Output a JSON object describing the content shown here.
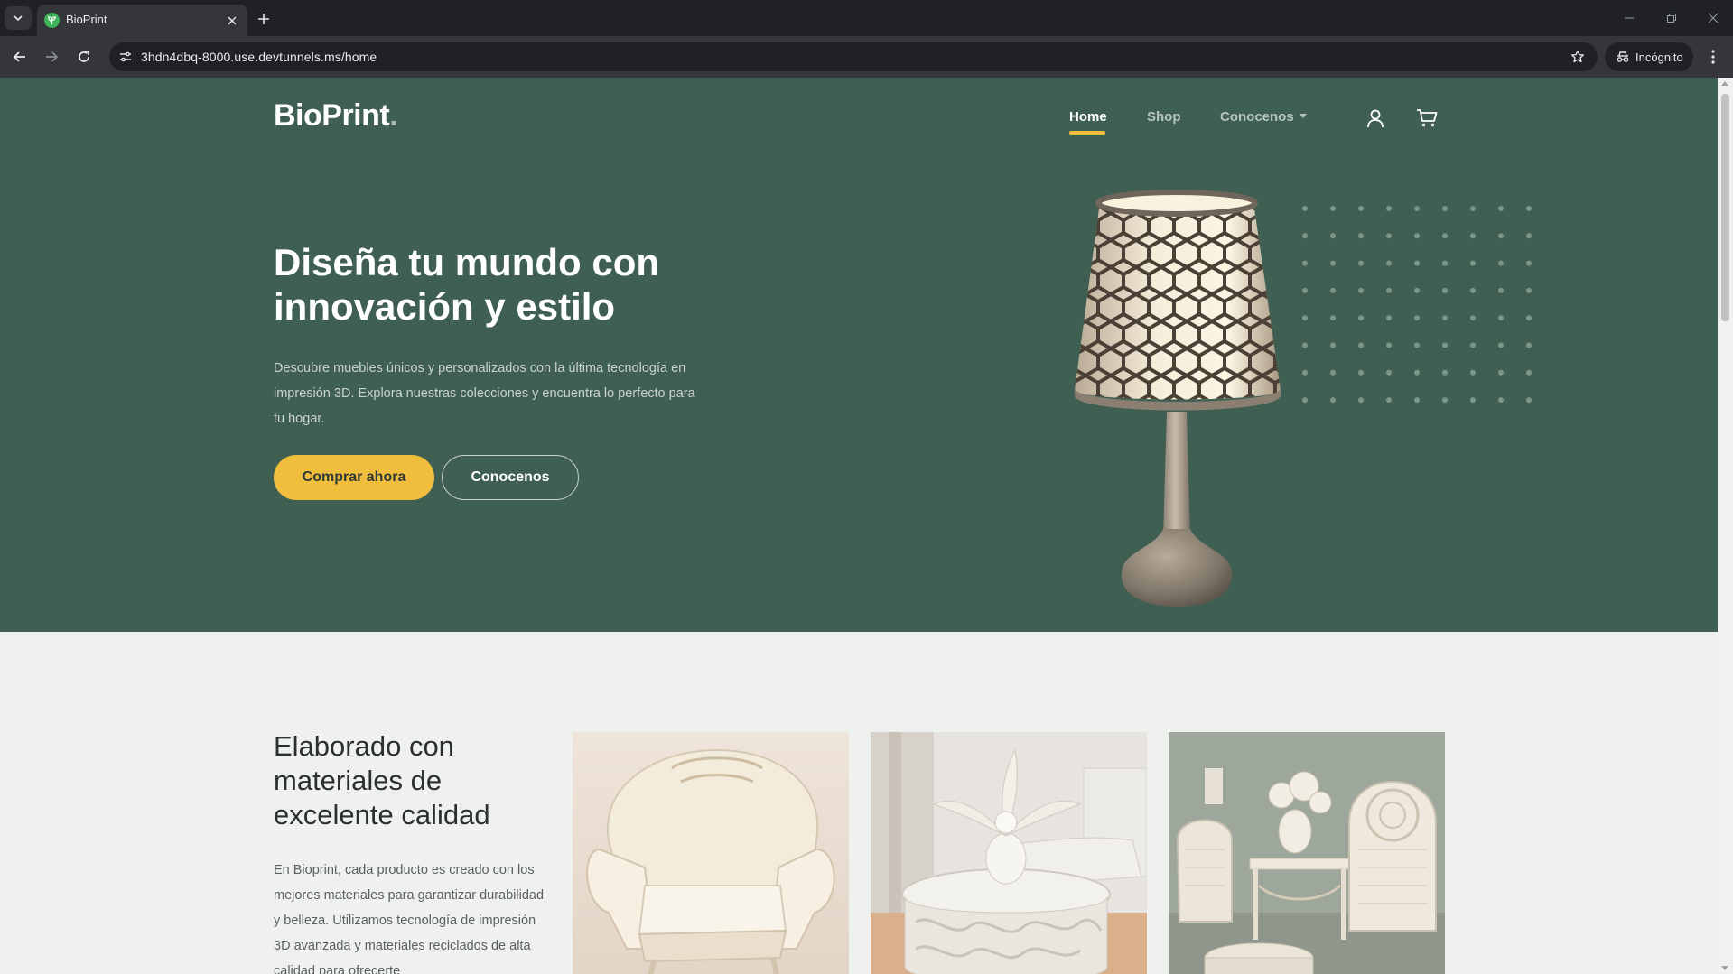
{
  "browser": {
    "tab_title": "BioPrint",
    "url_domain": "3hdn4dbq-8000.use.devtunnels.ms",
    "url_path": "/home",
    "incognito_label": "Incógnito"
  },
  "site": {
    "logo": "BioPrint",
    "logo_dot": ".",
    "nav": {
      "home": "Home",
      "shop": "Shop",
      "about": "Conocenos"
    }
  },
  "hero": {
    "title": "Diseña tu mundo con innovación y estilo",
    "description": "Descubre muebles únicos y personalizados con la última tecnología en impresión 3D. Explora nuestras colecciones y encuentra lo perfecto para tu hogar.",
    "primary_button": "Comprar ahora",
    "secondary_button": "Conocenos"
  },
  "quality": {
    "title": "Elaborado con materiales de excelente calidad",
    "description": "En Bioprint, cada producto es creado con los mejores materiales para garantizar durabilidad y belleza. Utilizamos tecnología de impresión 3D avanzada y materiales reciclados de alta calidad para ofrecerte"
  },
  "colors": {
    "hero_bg": "#3f5f53",
    "accent": "#f0bd3d",
    "section_bg": "#eff1ef"
  }
}
